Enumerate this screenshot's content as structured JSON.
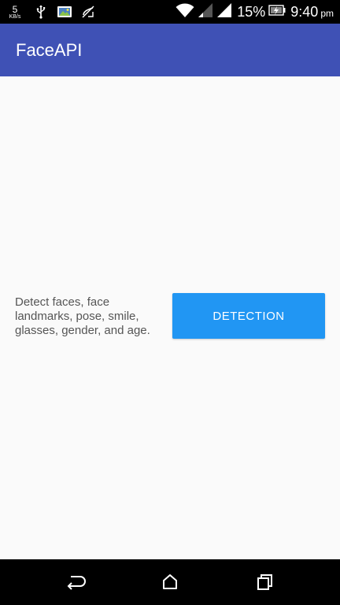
{
  "status_bar": {
    "speed_value": "5",
    "speed_unit": "KB/s",
    "icons_left": [
      "usb-icon",
      "gallery-icon",
      "missed-call-icon"
    ],
    "icons_right": [
      "wifi-icon",
      "signal-icon",
      "signal-icon",
      "battery-icon"
    ],
    "battery": "15%",
    "time": "9:40",
    "ampm": "pm"
  },
  "app_bar": {
    "title": "FaceAPI",
    "color": "#3f51b5"
  },
  "main": {
    "description": "Detect faces, face landmarks, pose, smile, glasses, gender, and age.",
    "detection_button": "DETECTION",
    "button_color": "#2196f3"
  },
  "nav_bar": {
    "icons": [
      "back-icon",
      "home-icon",
      "recents-icon"
    ]
  }
}
